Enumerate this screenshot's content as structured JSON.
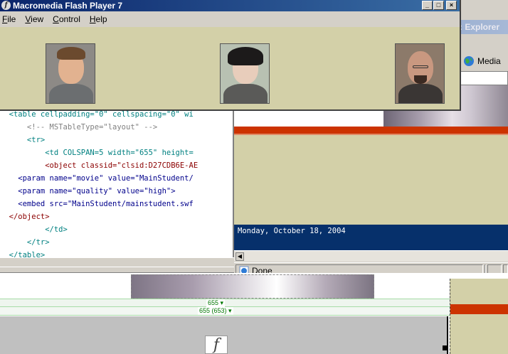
{
  "flash_window": {
    "title": "Macromedia Flash Player 7",
    "logo_glyph": "f",
    "menu": [
      "File",
      "View",
      "Control",
      "Help"
    ],
    "controls": {
      "minimize": "_",
      "maximize": "□",
      "close": "×"
    },
    "faces": [
      {
        "id": "person-1",
        "description": "young man with short brown hair"
      },
      {
        "id": "person-2",
        "description": "woman with dark hair"
      },
      {
        "id": "person-3",
        "description": "bald man with glasses and goatee"
      }
    ]
  },
  "code_editor": {
    "lines": [
      "  <table cellpadding=\"0\" cellspacing=\"0\" wi",
      "      <!-- MSTableType=\"layout\" -->",
      "      <tr>",
      "          <td COLSPAN=5 width=\"655\" height=",
      "          <object classid=\"clsid:D27CDB6E-AE",
      "    <param name=\"movie\" value=\"MainStudent/",
      "    <param name=\"quality\" value=\"high\">",
      "    <embed src=\"MainStudent/mainstudent.swf",
      "  </object>",
      "          </td>",
      "      </tr>",
      "  </table>"
    ]
  },
  "browser": {
    "title_fragment": ": Explorer",
    "toolbar": {
      "media_label": "Media"
    },
    "date_text": "Monday, October 18, 2004",
    "status": {
      "text": "Done"
    }
  },
  "design_view": {
    "ruler_width_label": "655 ▾",
    "ruler_width_detail_label": "655 (653) ▾",
    "flash_placeholder_glyph": "f"
  },
  "colors": {
    "stage_bg": "#d3d0a8",
    "accent_red": "#cc3300",
    "date_bar": "#06306b",
    "title_bar": "#0a246a"
  }
}
